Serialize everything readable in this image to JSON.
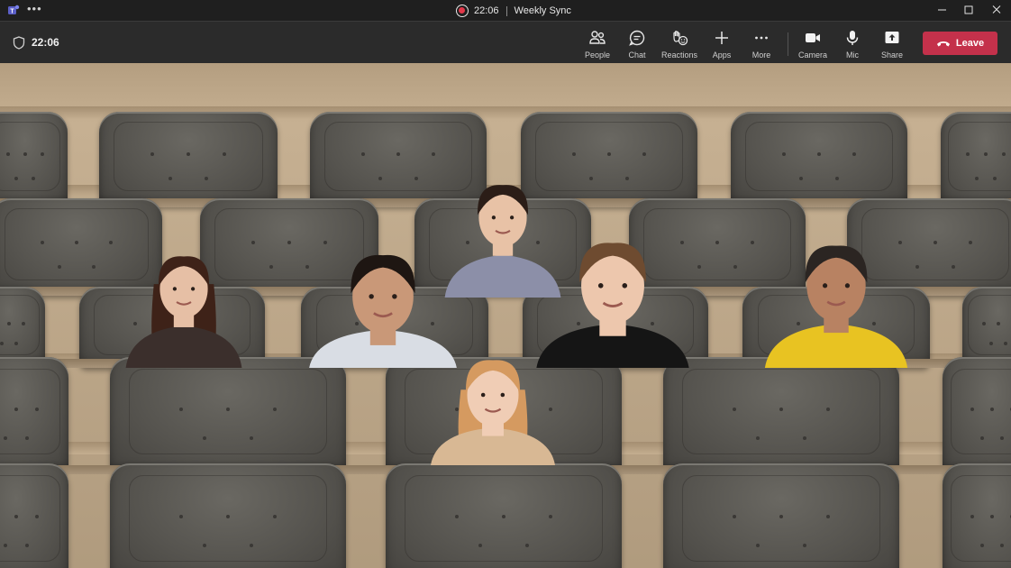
{
  "window": {
    "title_time": "22:06",
    "title_name": "Weekly Sync",
    "icons": [
      "teams-app-icon",
      "more-options-icon",
      "recording-icon",
      "minimize-icon",
      "maximize-icon",
      "close-icon"
    ]
  },
  "toolbar": {
    "meeting_time": "22:06",
    "people_label": "People",
    "chat_label": "Chat",
    "reactions_label": "Reactions",
    "apps_label": "Apps",
    "more_label": "More",
    "camera_label": "Camera",
    "mic_label": "Mic",
    "share_label": "Share",
    "leave_label": "Leave"
  },
  "colors": {
    "leave_button": "#c4314b",
    "recording": "#e3384a",
    "toolbar_bg": "#2b2b2b",
    "titlebar_bg": "#1f1f1f"
  },
  "stage": {
    "view": "together-mode-auditorium",
    "participant_count": 6
  }
}
